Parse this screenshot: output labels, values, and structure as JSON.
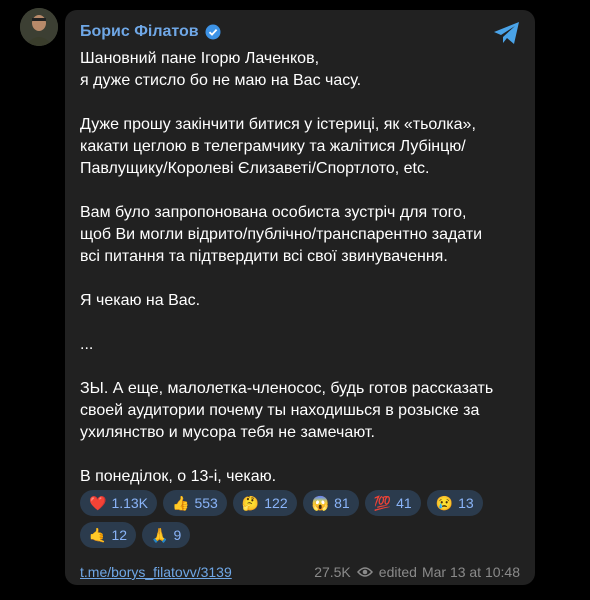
{
  "post": {
    "author": "Борис Філатов",
    "lines": [
      "Шановний пане Ігорю Лаченков,",
      "я дуже стисло бо не маю на Вас часу.",
      "",
      "Дуже прошу закінчити битися у істериці, як «тьолка»,",
      "какати цеглою в телеграмчику та жалітися Лубінцю/",
      "Павлущику/Королеві Єлизаветі/Спортлото, etc.",
      "",
      "Вам було запропонована особиста зустріч для того,",
      "щоб Ви могли відрито/публічно/транспарентно задати",
      "всі питання та підтвердити всі свої звинувачення.",
      "",
      "Я чекаю на Вас.",
      "",
      "...",
      "",
      "ЗЫ. А еще, малолетка-членосос, будь готов рассказать",
      "своей аудитории почему ты находишься в розыске за",
      "ухилянство и мусора тебя не замечают.",
      "",
      "В понеділок, о 13-і, чекаю."
    ],
    "reactions": [
      {
        "emoji": "❤️",
        "count": "1.13K"
      },
      {
        "emoji": "👍",
        "count": "553"
      },
      {
        "emoji": "🤔",
        "count": "122"
      },
      {
        "emoji": "😱",
        "count": "81"
      },
      {
        "emoji": "💯",
        "count": "41"
      },
      {
        "emoji": "😢",
        "count": "13"
      },
      {
        "emoji": "🤙",
        "count": "12"
      },
      {
        "emoji": "🙏",
        "count": "9"
      }
    ],
    "link": "t.me/borys_filatovv/3139",
    "views": "27.5K",
    "edited_label": "edited",
    "timestamp": "Mar 13 at 10:48"
  },
  "colors": {
    "background": "#000000",
    "bubble": "#212121",
    "accent": "#6fa7e6",
    "reaction_bg": "#2b3b4d"
  },
  "icons": {
    "verified": "verified-badge-icon",
    "telegram": "telegram-logo-icon",
    "views": "eye-icon"
  }
}
